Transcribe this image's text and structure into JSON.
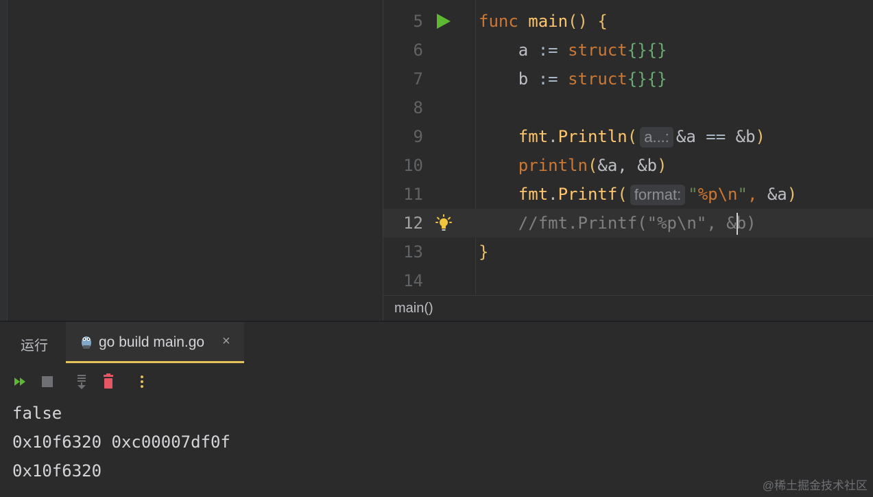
{
  "editor": {
    "lines": [
      {
        "number": "5"
      },
      {
        "number": "6"
      },
      {
        "number": "7"
      },
      {
        "number": "8"
      },
      {
        "number": "9"
      },
      {
        "number": "10"
      },
      {
        "number": "11"
      },
      {
        "number": "12"
      },
      {
        "number": "13"
      },
      {
        "number": "14"
      }
    ],
    "code": {
      "l5_kw": "func",
      "l5_fn": "main",
      "l5_paren": "()",
      "l5_brace": "{",
      "l6_var": "a",
      "l6_op": ":=",
      "l6_kw": "struct",
      "l6_br": "{}{}",
      "l7_var": "b",
      "l7_op": ":=",
      "l7_kw": "struct",
      "l7_br": "{}{}",
      "l9_pkg": "fmt",
      "l9_dot": ".",
      "l9_fn": "Println",
      "l9_open": "(",
      "l9_hint": "a...:",
      "l9_a": "&a",
      "l9_op": "==",
      "l9_b": "&b",
      "l9_close": ")",
      "l10_fn": "println",
      "l10_open": "(",
      "l10_args": "&a, &b",
      "l10_close": ")",
      "l11_pkg": "fmt",
      "l11_dot": ".",
      "l11_fn": "Printf",
      "l11_open": "(",
      "l11_hint": "format:",
      "l11_q1": "\"",
      "l11_fmt": "%p\\n",
      "l11_q2": "\"",
      "l11_comma": ",",
      "l11_arg": "&a",
      "l11_close": ")",
      "l12_comment_a": "//fmt.Printf(\"%p\\n\", &",
      "l12_comment_b": "b)",
      "l13_brace": "}"
    },
    "active_line": "12"
  },
  "breadcrumb": {
    "label": "main()"
  },
  "run_panel": {
    "title": "运行",
    "tab_label": "go build main.go",
    "close_glyph": "×"
  },
  "console": {
    "lines": [
      "false",
      "0x10f6320 0xc00007df0f",
      "0x10f6320"
    ]
  },
  "watermark": {
    "text": "@稀土掘金技术社区"
  },
  "colors": {
    "background": "#2b2b2b",
    "run_arrow": "#5fb832",
    "tab_underline": "#e6c25a",
    "delete_icon": "#e55765",
    "more_icon": "#e6c25a"
  }
}
